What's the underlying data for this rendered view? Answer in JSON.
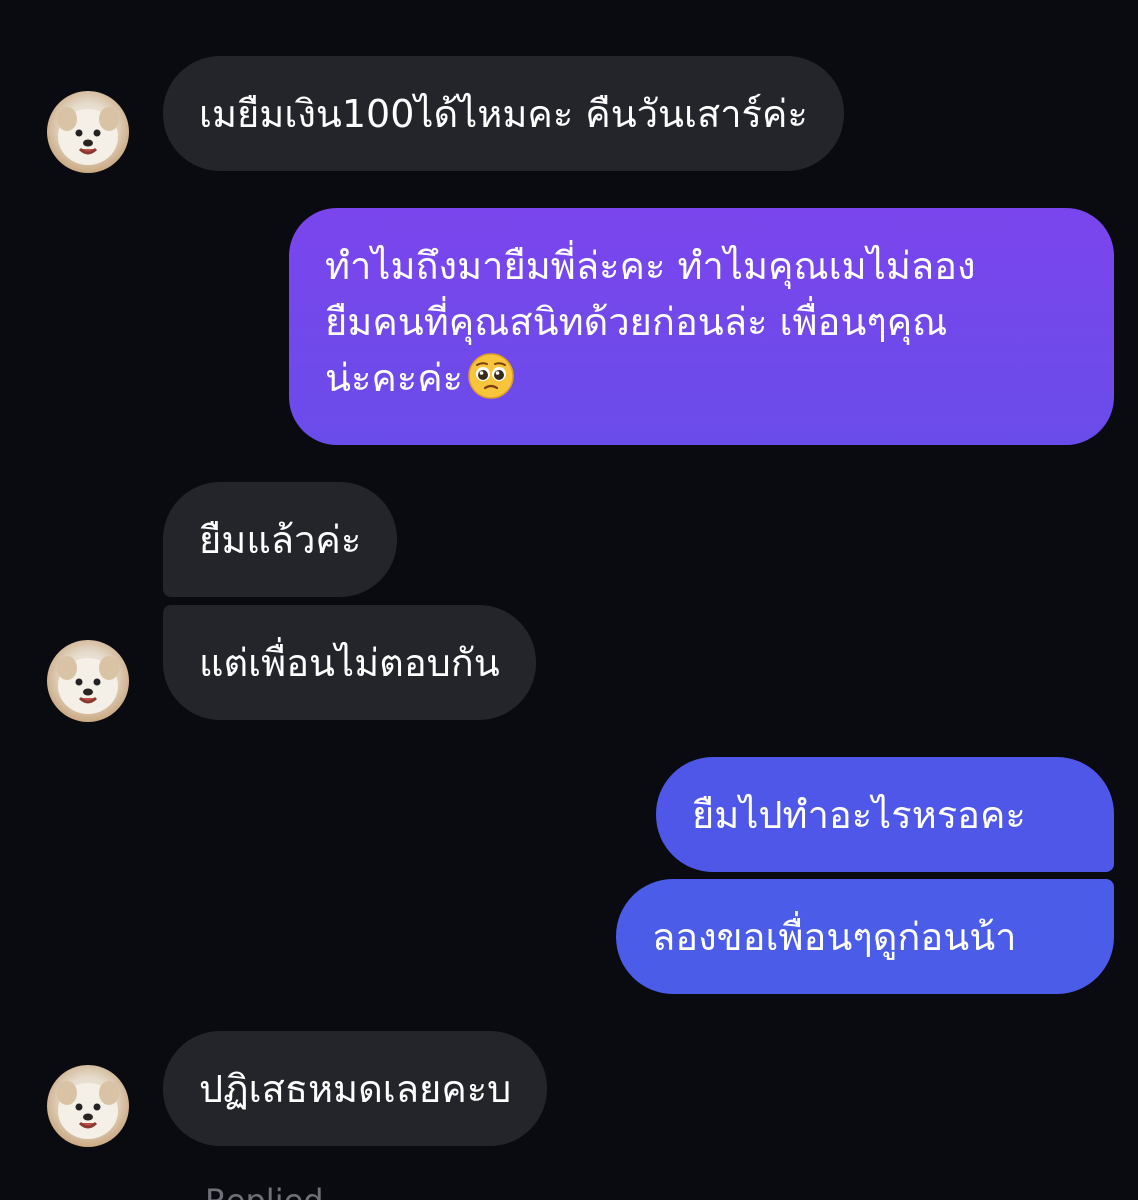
{
  "messages": [
    {
      "sender": "them",
      "text": "เมยืมเงิน100ได้ไหมคะ คืนวันเสาร์ค่ะ"
    },
    {
      "sender": "me",
      "lines": [
        "ทำไมถึงมายืมพี่ล่ะคะ ทำไมคุณเมไม่ลอง",
        "ยืมคนที่คุณสนิทด้วยก่อนล่ะ เพื่อนๆคุณ",
        "น่ะคะค่ะ"
      ],
      "emoji": "pleading-face-emoji"
    },
    {
      "sender": "them",
      "text": "ยืมแล้วค่ะ"
    },
    {
      "sender": "them",
      "text": "แต่เพื่อนไม่ตอบกัน"
    },
    {
      "sender": "me",
      "text": "ยืมไปทำอะไรหรอคะ"
    },
    {
      "sender": "me",
      "text": "ลองขอเพื่อนๆดูก่อนน้า"
    },
    {
      "sender": "them",
      "text": "ปฏิเสธหมดเลยคะบ"
    }
  ],
  "footer": {
    "partial_text": "Replied"
  },
  "colors": {
    "background": "#0a0b10",
    "incoming_bubble": "#23252b",
    "outgoing_purple": "#7a45ec",
    "outgoing_blue": "#4b5ae8",
    "text": "#ffffff"
  }
}
